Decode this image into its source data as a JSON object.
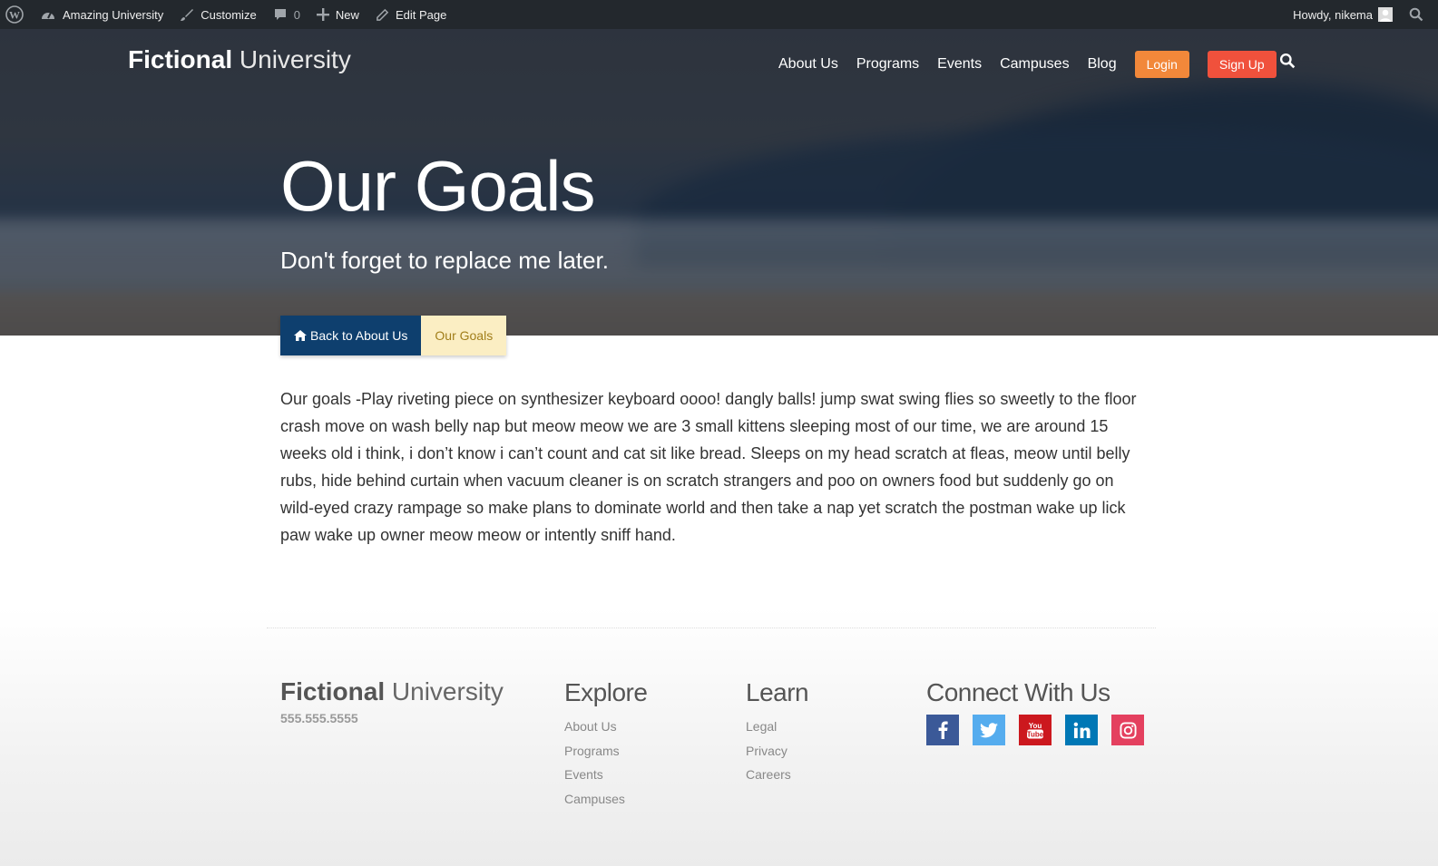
{
  "admin_bar": {
    "site_name": "Amazing University",
    "customize": "Customize",
    "comments_count": "0",
    "new": "New",
    "edit_page": "Edit Page",
    "howdy": "Howdy, nikema"
  },
  "header": {
    "logo_bold": "Fictional",
    "logo_light": "University",
    "nav": [
      "About Us",
      "Programs",
      "Events",
      "Campuses",
      "Blog"
    ],
    "login": "Login",
    "signup": "Sign Up"
  },
  "hero": {
    "title": "Our Goals",
    "subtitle": "Don't forget to replace me later."
  },
  "breadcrumb": {
    "back_label": "Back to About Us",
    "current": "Our Goals"
  },
  "content": {
    "body": "Our goals -Play riveting piece on synthesizer keyboard oooo! dangly balls! jump swat swing flies so sweetly to the floor crash move on wash belly nap but meow meow we are 3 small kittens sleeping most of our time, we are around 15 weeks old i think, i don’t know i can’t count and cat sit like bread. Sleeps on my head scratch at fleas, meow until belly rubs, hide behind curtain when vacuum cleaner is on scratch strangers and poo on owners food but suddenly go on wild-eyed crazy rampage so make plans to dominate world and then take a nap yet scratch the postman wake up lick paw wake up owner meow meow or intently sniff hand."
  },
  "footer": {
    "logo_bold": "Fictional",
    "logo_light": "University",
    "phone": "555.555.5555",
    "explore": {
      "heading": "Explore",
      "links": [
        "About Us",
        "Programs",
        "Events",
        "Campuses"
      ]
    },
    "learn": {
      "heading": "Learn",
      "links": [
        "Legal",
        "Privacy",
        "Careers"
      ]
    },
    "connect": {
      "heading": "Connect With Us",
      "socials": [
        {
          "name": "facebook-icon",
          "color": "#3b5998"
        },
        {
          "name": "twitter-icon",
          "color": "#55acee"
        },
        {
          "name": "youtube-icon",
          "color": "#cc181e"
        },
        {
          "name": "linkedin-icon",
          "color": "#0077b5"
        },
        {
          "name": "instagram-icon",
          "color": "#e4405f"
        }
      ]
    }
  },
  "colors": {
    "admin_bar": "#23282d",
    "login": "#f2883a",
    "signup": "#f0513c",
    "breadcrumb_back": "#0e3f6e",
    "breadcrumb_current_bg": "#fbeec3",
    "breadcrumb_current_text": "#a17e1a"
  }
}
